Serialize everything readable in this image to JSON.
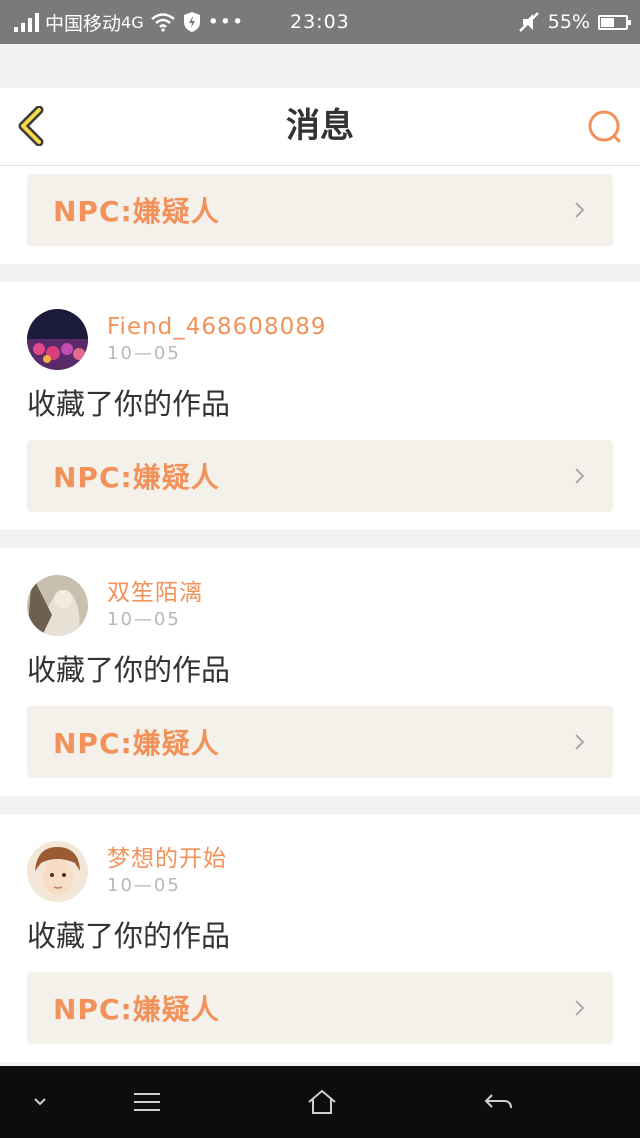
{
  "status_bar": {
    "carrier": "中国移动",
    "network": "4G",
    "time": "23:03",
    "battery_text": "55%",
    "battery_level": 0.55,
    "icons": [
      "signal-icon",
      "wifi-icon",
      "shield-icon",
      "more-dots-icon",
      "mute-icon",
      "battery-icon"
    ]
  },
  "header": {
    "title": "消息",
    "back_icon": "chevron-left-icon",
    "search_icon": "search-icon",
    "accent_color": "#f2925a"
  },
  "messages": [
    {
      "work_title": "NPC:嫌疑人",
      "partial": true
    },
    {
      "username": "Fiend_468608089",
      "date": "10—05",
      "action": "收藏了你的作品",
      "work_title": "NPC:嫌疑人"
    },
    {
      "username": "双笙陌漓",
      "date": "10—05",
      "action": "收藏了你的作品",
      "work_title": "NPC:嫌疑人"
    },
    {
      "username": "梦想的开始",
      "date": "10—05",
      "action": "收藏了你的作品",
      "work_title": "NPC:嫌疑人"
    }
  ],
  "nav_bar": {
    "buttons": [
      "chevron-down-icon",
      "menu-icon",
      "home-icon",
      "back-arrow-icon"
    ]
  }
}
